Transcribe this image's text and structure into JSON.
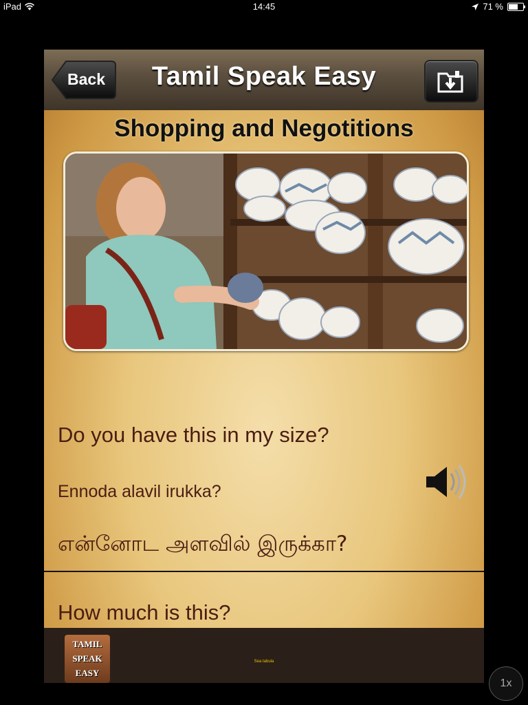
{
  "status_bar": {
    "device": "iPad",
    "time": "14:45",
    "battery": "71 %",
    "battery_level": 0.71
  },
  "navbar": {
    "back_label": "Back",
    "title": "Tamil Speak Easy",
    "folder_icon": "folder-download-icon"
  },
  "section": {
    "title": "Shopping and Negotitions"
  },
  "photo": {
    "alt_icon": "shopping-photo"
  },
  "phrases": [
    {
      "english": "Do you have this in my size?",
      "transliteration": "Ennoda alavil irukka?",
      "tamil": "என்னோட அளவில் இருக்கா?"
    },
    {
      "english": "How much is this?"
    }
  ],
  "footer": {
    "logo_lines": [
      "TAMIL",
      "SPEAK",
      "EASY"
    ],
    "ad_text": "Sea tabula"
  },
  "zoom": {
    "label": "1x"
  }
}
